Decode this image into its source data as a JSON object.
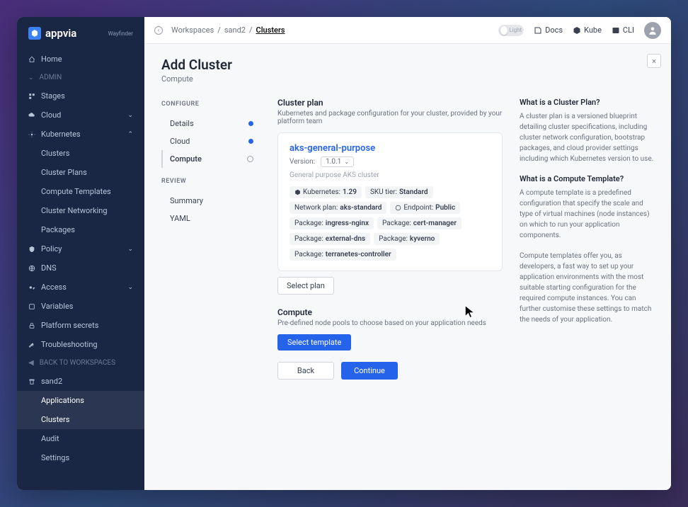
{
  "brand": {
    "name": "appvia",
    "sub": "Wayfinder"
  },
  "sidebar": {
    "home": "Home",
    "admin_label": "ADMIN",
    "stages": "Stages",
    "cloud": "Cloud",
    "kubernetes": "Kubernetes",
    "k8s_children": [
      "Clusters",
      "Cluster Plans",
      "Compute Templates",
      "Cluster Networking",
      "Packages"
    ],
    "policy": "Policy",
    "dns": "DNS",
    "access": "Access",
    "variables": "Variables",
    "platform_secrets": "Platform secrets",
    "troubleshooting": "Troubleshooting",
    "back_label": "BACK TO WORKSPACES",
    "workspace": "sand2",
    "ws_children": [
      "Applications",
      "Clusters",
      "Audit",
      "Settings"
    ]
  },
  "topbar": {
    "crumb1": "Workspaces",
    "crumb2": "sand2",
    "crumb3": "Clusters",
    "toggle_label": "Light",
    "docs": "Docs",
    "kube": "Kube",
    "cli": "CLI"
  },
  "page": {
    "title": "Add Cluster",
    "subtitle": "Compute",
    "close": "×"
  },
  "wizard": {
    "configure": "CONFIGURE",
    "review": "REVIEW",
    "steps": [
      "Details",
      "Cloud",
      "Compute"
    ],
    "review_steps": [
      "Summary",
      "YAML"
    ]
  },
  "plan": {
    "section_title": "Cluster plan",
    "section_desc": "Kubernetes and package configuration for your cluster, provided by your platform team",
    "name": "aks-general-purpose",
    "version_label": "Version:",
    "version_value": "1.0.1",
    "desc": "General purpose AKS cluster",
    "tags": [
      {
        "label": "Kubernetes:",
        "value": "1.29"
      },
      {
        "label": "SKU tier:",
        "value": "Standard"
      },
      {
        "label": "Network plan:",
        "value": "aks-standard"
      },
      {
        "label": "Endpoint:",
        "value": "Public"
      },
      {
        "label": "Package:",
        "value": "ingress-nginx"
      },
      {
        "label": "Package:",
        "value": "cert-manager"
      },
      {
        "label": "Package:",
        "value": "external-dns"
      },
      {
        "label": "Package:",
        "value": "kyverno"
      },
      {
        "label": "Package:",
        "value": "terranetes-controller"
      }
    ],
    "select_plan": "Select plan"
  },
  "compute": {
    "section_title": "Compute",
    "section_desc": "Pre-defined node pools to choose based on your application needs",
    "select_template": "Select template"
  },
  "buttons": {
    "back": "Back",
    "continue": "Continue"
  },
  "help": {
    "t1": "What is a Cluster Plan?",
    "p1": "A cluster plan is a versioned blueprint detailing cluster specifications, including cluster network configuration, bootstrap packages, and cloud provider settings including which Kubernetes version to use.",
    "t2": "What is a Compute Template?",
    "p2": "A compute template is a predefined configuration that specify the scale and type of virtual machines (node instances) on which to run your application components.",
    "p3": "Compute templates offer you, as developers, a fast way to set up your application environments with the most suitable starting configuration for the required compute instances. You can further customise these settings to match the needs of your application."
  }
}
